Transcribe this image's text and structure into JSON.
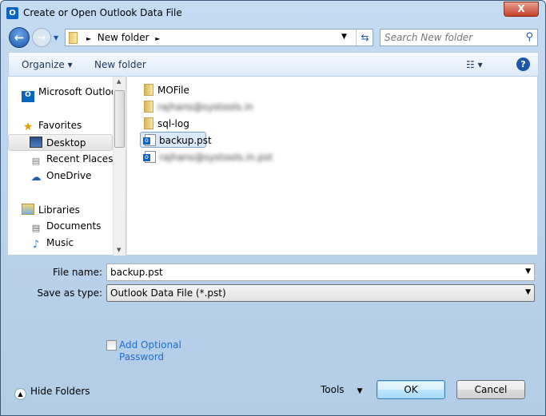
{
  "window": {
    "title": "Create or Open Outlook Data File",
    "close_label": "X",
    "app_icon": "O"
  },
  "nav_bar": {
    "back_icon": "←",
    "forward_icon": "→",
    "history_icon": "▼",
    "breadcrumb": [
      "New folder"
    ],
    "sep": "►",
    "dropdown": "▼",
    "refresh_icon": "⇆",
    "search_placeholder": "Search New folder",
    "search_icon": "⚲"
  },
  "toolbar": {
    "organize": "Organize ▾",
    "new_folder": "New folder",
    "views_icon": "☷ ▾",
    "help": "?"
  },
  "sidebar": {
    "items": [
      {
        "label": "Microsoft Outloo",
        "icon": "outlook-icon"
      },
      {
        "label": "Favorites",
        "icon": "star-icon"
      },
      {
        "label": "Desktop",
        "icon": "desktop-icon",
        "selected": true
      },
      {
        "label": "Recent Places",
        "icon": "recent-places-icon"
      },
      {
        "label": "OneDrive",
        "icon": "onedrive-icon"
      },
      {
        "label": "Libraries",
        "icon": "libraries-icon"
      },
      {
        "label": "Documents",
        "icon": "documents-icon"
      },
      {
        "label": "Music",
        "icon": "music-icon"
      }
    ]
  },
  "files": [
    {
      "name": "MOFile",
      "type": "folder"
    },
    {
      "name": "rajhans@systools.in",
      "type": "folder",
      "blurred": true
    },
    {
      "name": "sql-log",
      "type": "folder"
    },
    {
      "name": "backup.pst",
      "type": "pst",
      "selected": true
    },
    {
      "name": "rajhans@systools.in.pst",
      "type": "pst",
      "blurred": true
    }
  ],
  "form": {
    "file_name_label": "File name:",
    "file_name_value": "backup.pst",
    "save_type_label": "Save as type:",
    "save_type_value": "Outlook Data File (*.pst)",
    "optional_password": "Add Optional Password",
    "optional_password_line1": "Add Optional",
    "optional_password_line2": "Password",
    "optional_password_checked": false
  },
  "footer": {
    "hide_folders": "Hide Folders",
    "tools": "Tools",
    "ok": "OK",
    "cancel": "Cancel"
  }
}
